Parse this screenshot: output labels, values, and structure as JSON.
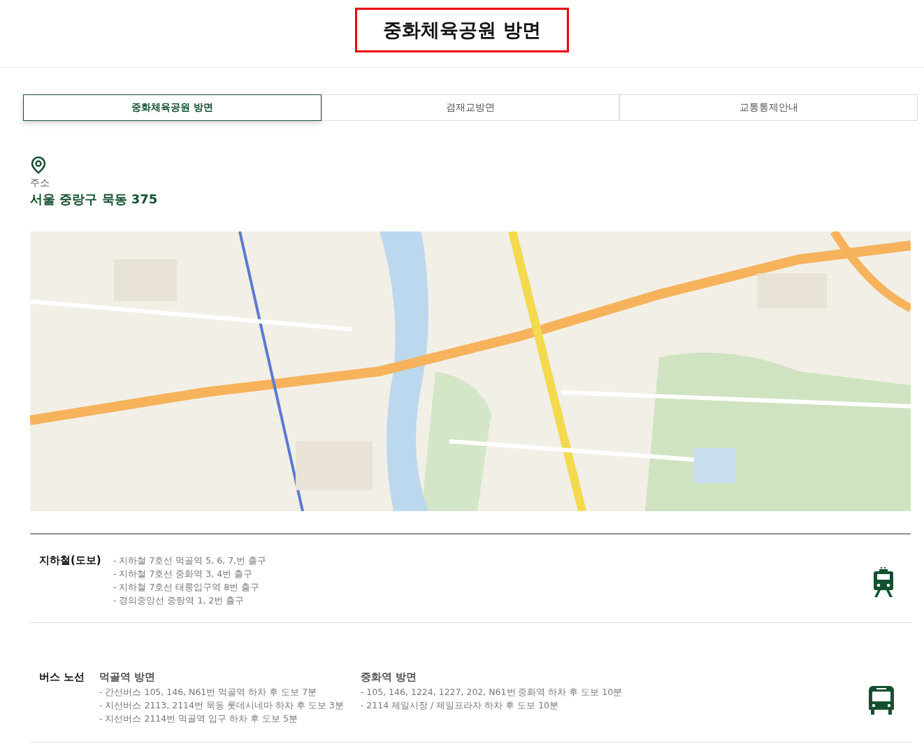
{
  "header": {
    "title": "중화체육공원 방면"
  },
  "tabs": [
    {
      "label": "중화체육공원 방면",
      "selected": true
    },
    {
      "label": "겸재교방면",
      "selected": false
    },
    {
      "label": "교통통제안내",
      "selected": false
    }
  ],
  "address": {
    "label": "주소",
    "value": "서울 중랑구 묵동 375"
  },
  "subway": {
    "title": "지하철(도보)",
    "lines": [
      "- 지하철 7호선 먹골역 5, 6, 7,번 출구",
      "- 지하철 7호선 중화역 3, 4번 출구",
      "- 지하철 7호선 태릉입구역 8번 출구",
      "- 경의중앙선 중랑역 1, 2번 출구"
    ]
  },
  "bus": {
    "title": "버스 노선",
    "groups": [
      {
        "title": "먹골역 방면",
        "lines": [
          "- 간선버스 105, 146, N61번 먹골역 하차 후 도보 7분",
          "- 지선버스 2113, 2114번 묵동 롯데시네마 하차 후 도보 3분",
          "- 지선버스 2114번 먹골역 입구 하차 후 도보 5분"
        ]
      },
      {
        "title": "중화역 방면",
        "lines": [
          "- 105, 146, 1224, 1227, 202, N61번 중화역 하차 후 도보 10분",
          "- 2114 제일시장 / 제일프라자 하차 후 도보 10분"
        ]
      }
    ]
  }
}
